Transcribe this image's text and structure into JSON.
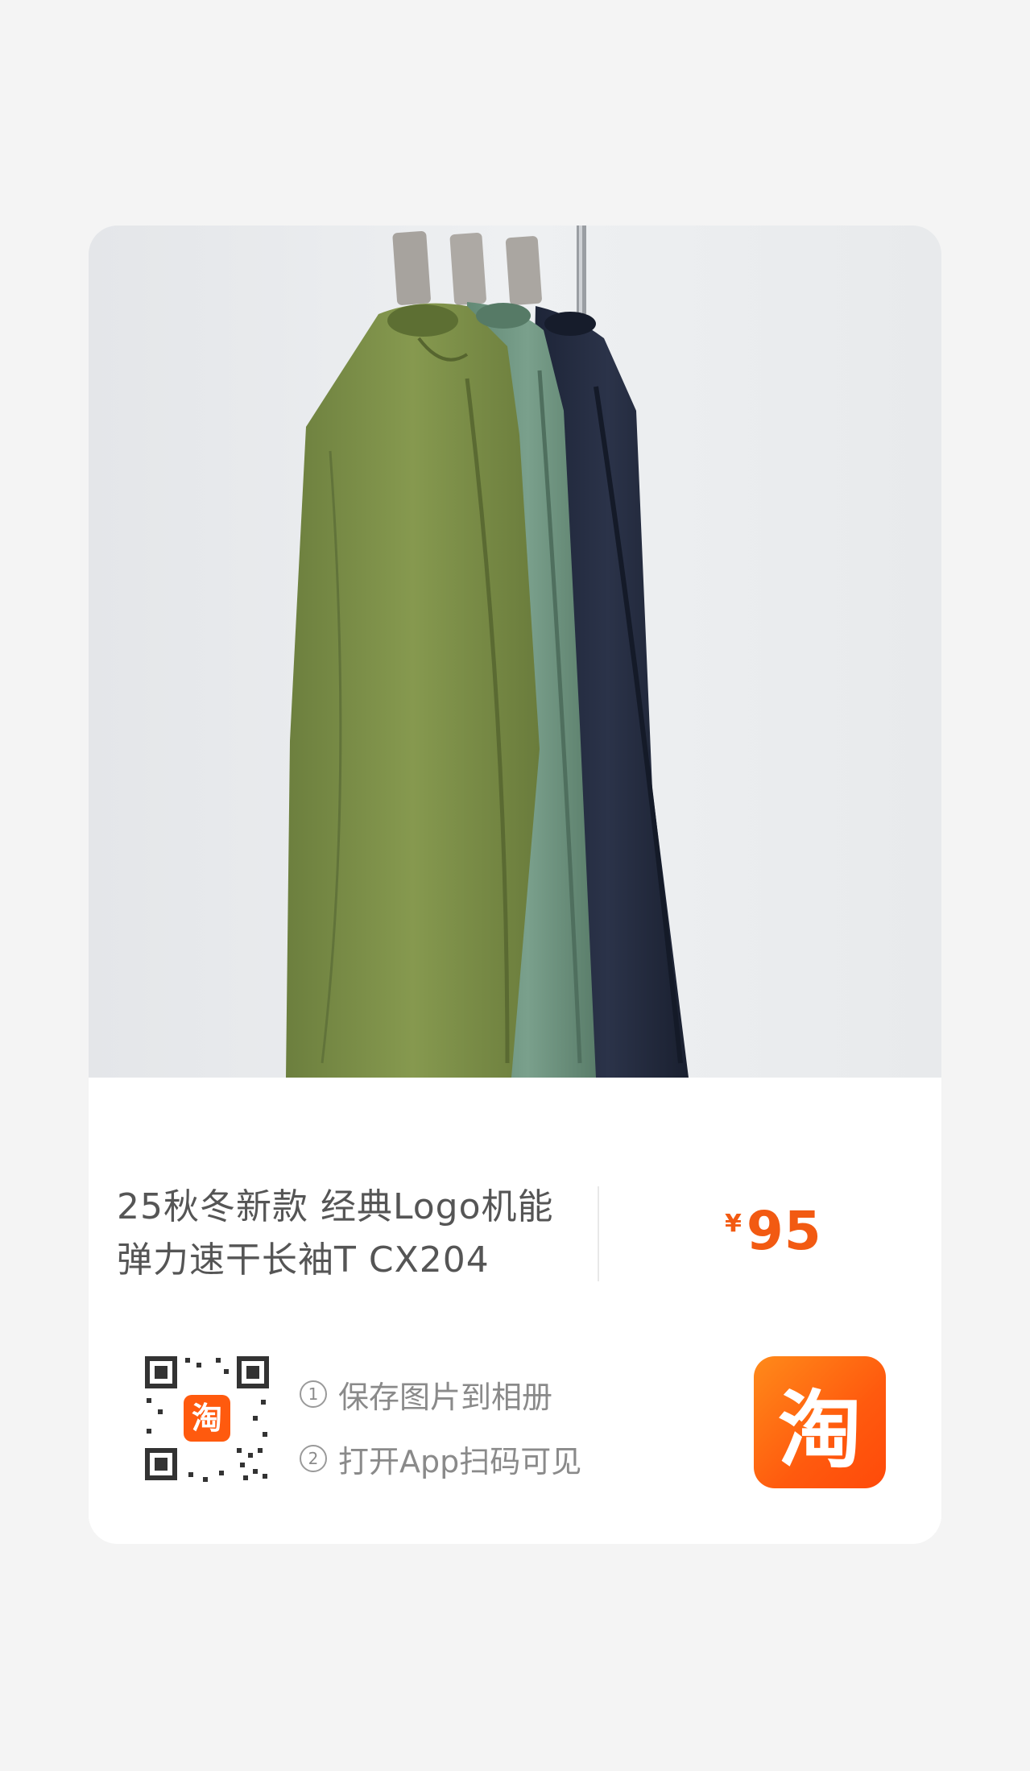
{
  "product": {
    "title_line1": "25秋冬新款 经典Logo机能",
    "title_line2": "弹力速干长袖T CX204",
    "currency": "¥",
    "price": "95"
  },
  "share": {
    "qr_badge": "淘",
    "steps": [
      {
        "num": "1",
        "text": "保存图片到相册"
      },
      {
        "num": "2",
        "text": "打开App扫码可见"
      }
    ]
  },
  "app_logo": {
    "glyph": "淘",
    "icon": "taobao-logo-icon"
  },
  "colors": {
    "accent": "#f25a12",
    "logo": "#ff5a0e"
  }
}
